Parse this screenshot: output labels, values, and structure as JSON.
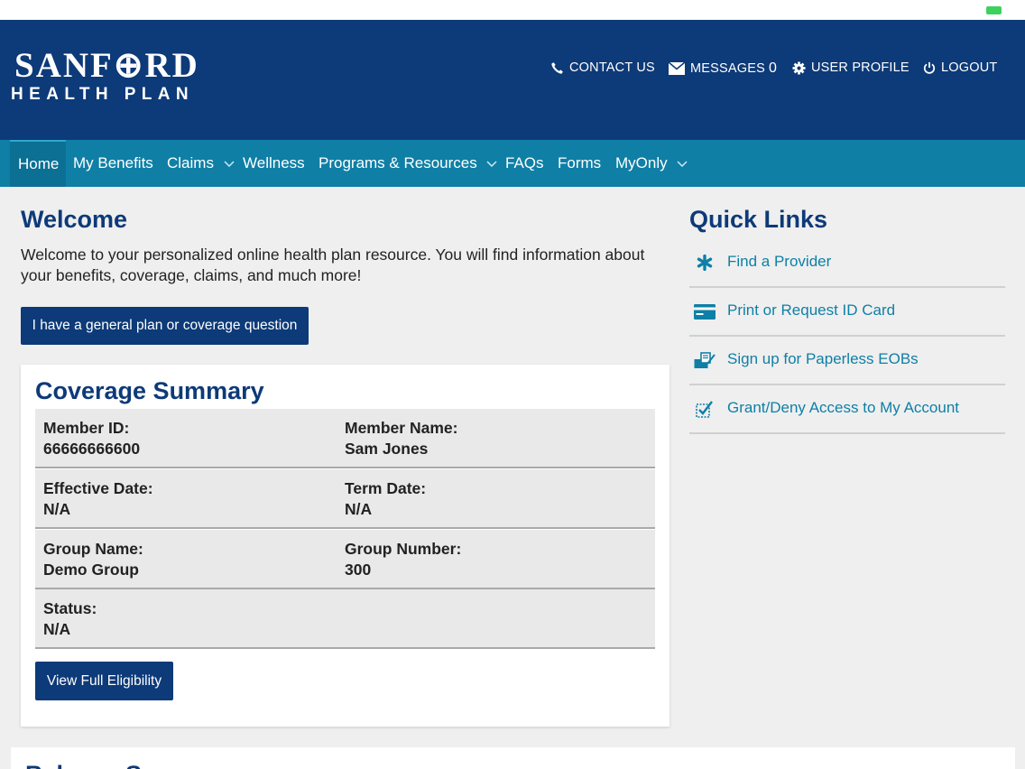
{
  "header": {
    "logo_top": "SANF⊕RD",
    "logo_bottom": "HEALTH PLAN",
    "contact_label": "CONTACT US",
    "messages_label": "MESSAGES",
    "messages_count": "0",
    "profile_label": "USER PROFILE",
    "logout_label": "LOGOUT"
  },
  "nav": {
    "items": [
      {
        "label": "Home",
        "active": true
      },
      {
        "label": "My Benefits"
      },
      {
        "label": "Claims",
        "dropdown": true
      },
      {
        "label": "Wellness"
      },
      {
        "label": "Programs & Resources",
        "dropdown": true
      },
      {
        "label": "FAQs"
      },
      {
        "label": "Forms"
      },
      {
        "label": "MyOnly",
        "dropdown": true
      }
    ]
  },
  "welcome": {
    "title": "Welcome",
    "text": "Welcome to your personalized online health plan resource.  You will find information about your benefits, coverage, claims, and much more!",
    "question_button": "I have a general plan or coverage question"
  },
  "coverage": {
    "title": "Coverage Summary",
    "rows": [
      [
        {
          "label": "Member ID:",
          "value": "66666666600"
        },
        {
          "label": "Member Name:",
          "value": "Sam Jones"
        }
      ],
      [
        {
          "label": "Effective Date:",
          "value": "N/A"
        },
        {
          "label": "Term Date:",
          "value": "N/A"
        }
      ],
      [
        {
          "label": "Group Name:",
          "value": "Demo Group"
        },
        {
          "label": "Group Number:",
          "value": "300"
        }
      ],
      [
        {
          "label": "Status:",
          "value": "N/A"
        }
      ]
    ],
    "eligibility_button": "View Full Eligibility"
  },
  "quick_links": {
    "title": "Quick Links",
    "items": [
      {
        "label": "Find a Provider",
        "icon": "asterisk-icon"
      },
      {
        "label": "Print or Request ID Card",
        "icon": "id-card-icon"
      },
      {
        "label": "Sign up for Paperless EOBs",
        "icon": "paperless-icon"
      },
      {
        "label": "Grant/Deny Access to My Account",
        "icon": "checklist-icon"
      }
    ]
  },
  "next_section": {
    "title": "Balance Summary"
  },
  "colors": {
    "header": "#0d3a78",
    "nav": "#0f7fa6",
    "link": "#0f7fa6",
    "background": "#efefef"
  }
}
